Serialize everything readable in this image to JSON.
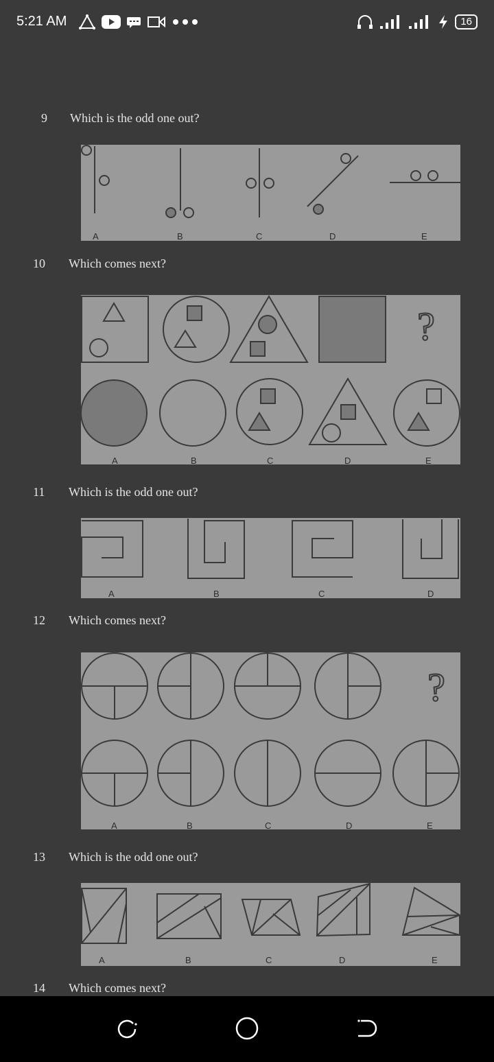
{
  "status_bar": {
    "time": "5:21 AM",
    "battery_level": "16"
  },
  "questions": [
    {
      "number": "9",
      "text": "Which is the odd one out?",
      "labels": [
        "A",
        "B",
        "C",
        "D",
        "E"
      ]
    },
    {
      "number": "10",
      "text": "Which comes next?",
      "labels": [
        "A",
        "B",
        "C",
        "D",
        "E"
      ]
    },
    {
      "number": "11",
      "text": "Which is the odd one out?",
      "labels": [
        "A",
        "B",
        "C",
        "D"
      ]
    },
    {
      "number": "12",
      "text": "Which comes next?",
      "labels": [
        "A",
        "B",
        "C",
        "D",
        "E"
      ]
    },
    {
      "number": "13",
      "text": "Which is the odd one out?",
      "labels": [
        "A",
        "B",
        "C",
        "D",
        "E"
      ]
    },
    {
      "number": "14",
      "text": "Which comes next?"
    }
  ],
  "colors": {
    "background": "#3a3a3a",
    "panel": "#9a9a9a",
    "ink": "#3a3a3a",
    "fill_dark": "#7a7a7a"
  },
  "icons": [
    "headset-icon",
    "signal-icon",
    "charging-icon",
    "youtube-icon",
    "message-icon",
    "video-icon",
    "more-dots-icon"
  ]
}
